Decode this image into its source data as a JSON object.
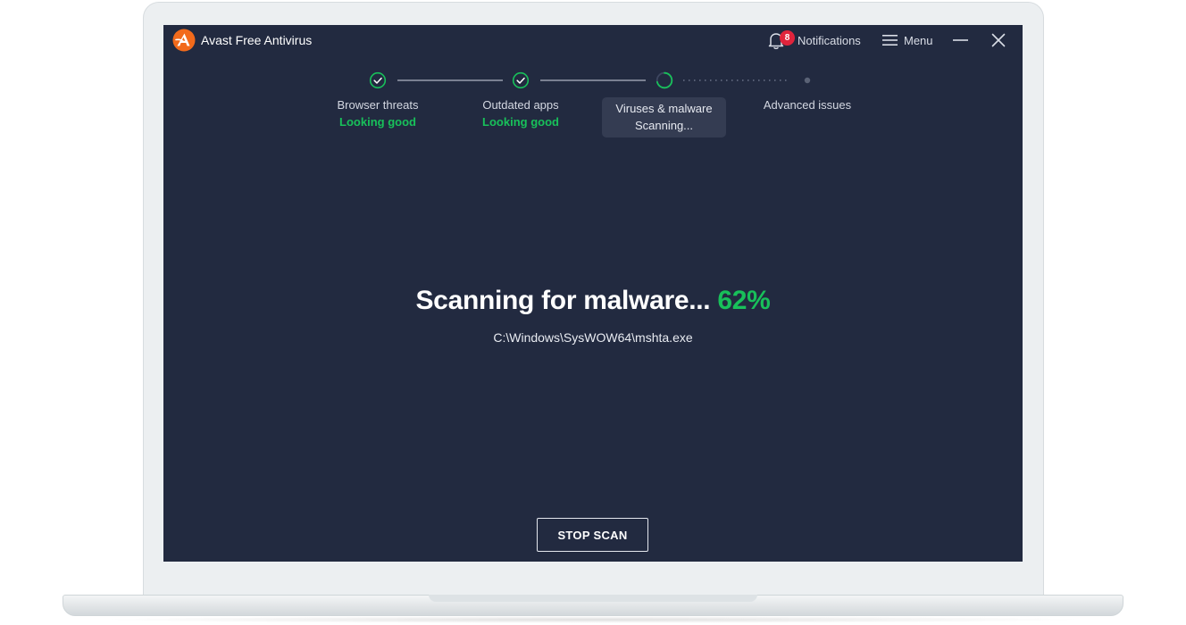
{
  "app": {
    "title": "Avast Free Antivirus",
    "logo_icon": "avast-logo-icon",
    "brand_color": "#f26a1b"
  },
  "header": {
    "notifications": {
      "label": "Notifications",
      "count": "8",
      "icon": "bell-icon"
    },
    "menu": {
      "label": "Menu",
      "icon": "hamburger-icon"
    },
    "window_controls": {
      "minimize_icon": "minimize-icon",
      "close_icon": "close-icon"
    }
  },
  "steps": [
    {
      "label": "Browser threats",
      "status": "Looking good",
      "state": "done"
    },
    {
      "label": "Outdated apps",
      "status": "Looking good",
      "state": "done"
    },
    {
      "label": "Viruses & malware",
      "status": "Scanning...",
      "state": "active"
    },
    {
      "label": "Advanced issues",
      "status": "",
      "state": "pending"
    }
  ],
  "scan": {
    "heading": "Scanning for malware...",
    "percent_label": "62%",
    "progress": 0.62,
    "current_file": "C:\\Windows\\SysWOW64\\mshta.exe"
  },
  "actions": {
    "stop_label": "STOP SCAN"
  },
  "colors": {
    "background": "#222a40",
    "success": "#18c05a",
    "badge": "#e0243c",
    "active_step_bg": "#343c52"
  }
}
